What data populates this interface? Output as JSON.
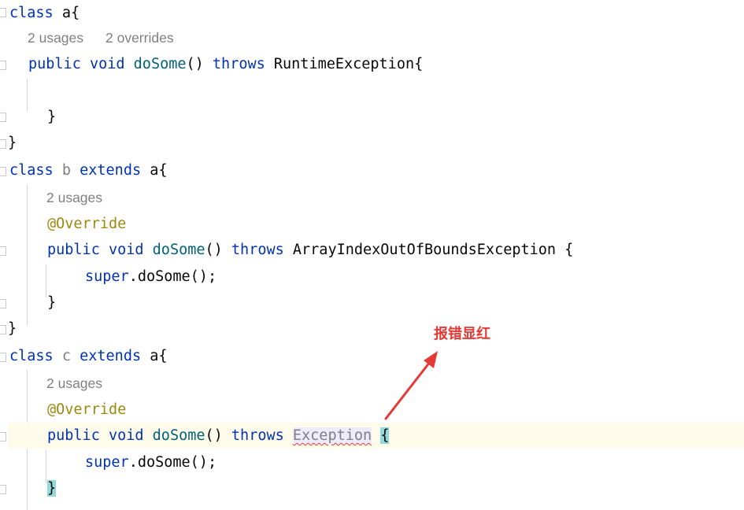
{
  "editor": {
    "class_kw": "class",
    "extends_kw": "extends",
    "public_kw": "public",
    "void_kw": "void",
    "throws_kw": "throws",
    "super_kw": "super",
    "annotation": "@Override",
    "method_name": "doSome",
    "parens": "()",
    "call_tail": ".doSome();",
    "open_brace": "{",
    "close_brace": "}",
    "class_a": {
      "name": "a",
      "usages_hint": "2 usages",
      "overrides_hint": "2 overrides",
      "exception": "RuntimeException"
    },
    "class_b": {
      "name": "b",
      "parent": "a",
      "usages_hint": "2 usages",
      "exception": "ArrayIndexOutOfBoundsException"
    },
    "class_c": {
      "name": "c",
      "parent": "a",
      "usages_hint": "2 usages",
      "exception": "Exception"
    }
  },
  "annotation_note": {
    "text": "报错显红",
    "color": "#e53935"
  }
}
